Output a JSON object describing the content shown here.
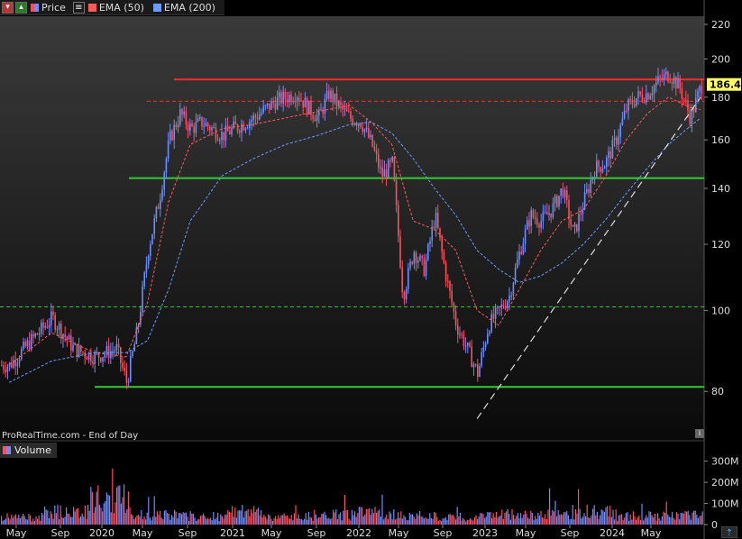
{
  "legend": {
    "price_label": "Price",
    "ema50_label": "EMA (50)",
    "ema200_label": "EMA (200)"
  },
  "volume_legend": {
    "label": "Volume"
  },
  "source_label": "ProRealTime.com - End of Day",
  "last_price": "186.43",
  "colors": {
    "background": "#000000",
    "candle_up": "#6b8dff",
    "candle_down": "#ff4d5a",
    "ema50": "#ff5a5a",
    "ema200": "#6a9cff",
    "resistance": "#ff2a2a",
    "support": "#33cc33",
    "trendline": "#dddddd",
    "last_price_badge": "#ffff66"
  },
  "chart_data": [
    {
      "type": "line",
      "title": "",
      "y_scale": "log",
      "ylim": [
        70,
        225
      ],
      "y_ticks": [
        80,
        100,
        120,
        140,
        160,
        180,
        200,
        220
      ],
      "x_ticks": [
        "May",
        "Sep",
        "2020",
        "May",
        "Sep",
        "2021",
        "May",
        "Sep",
        "2022",
        "May",
        "Sep",
        "2023",
        "May",
        "Sep",
        "2024",
        "May"
      ],
      "x_range": [
        "2019-04",
        "2024-09"
      ],
      "series": [
        {
          "name": "Price",
          "style": "candlestick",
          "x": [
            "2019-04",
            "2019-06",
            "2019-08",
            "2019-10",
            "2019-12",
            "2020-02",
            "2020-03",
            "2020-04",
            "2020-05",
            "2020-06",
            "2020-07",
            "2020-08",
            "2020-09",
            "2020-10",
            "2020-12",
            "2021-01",
            "2021-03",
            "2021-05",
            "2021-07",
            "2021-08",
            "2021-09",
            "2021-10",
            "2021-11",
            "2021-12",
            "2022-01",
            "2022-02",
            "2022-03",
            "2022-04",
            "2022-05",
            "2022-06",
            "2022-07",
            "2022-08",
            "2022-09",
            "2022-10",
            "2022-11",
            "2022-12",
            "2023-01",
            "2023-02",
            "2023-03",
            "2023-04",
            "2023-05",
            "2023-06",
            "2023-07",
            "2023-08",
            "2023-09",
            "2023-10",
            "2023-11",
            "2023-12",
            "2024-01",
            "2024-02",
            "2024-03",
            "2024-04",
            "2024-05",
            "2024-06",
            "2024-07",
            "2024-08",
            "2024-09"
          ],
          "values": [
            86,
            92,
            98,
            90,
            88,
            90,
            82,
            95,
            118,
            135,
            160,
            172,
            165,
            168,
            162,
            165,
            170,
            178,
            182,
            175,
            170,
            182,
            175,
            170,
            168,
            158,
            145,
            150,
            104,
            118,
            112,
            130,
            110,
            96,
            90,
            84,
            96,
            100,
            104,
            118,
            130,
            128,
            132,
            140,
            123,
            135,
            148,
            150,
            160,
            175,
            180,
            182,
            188,
            192,
            185,
            170,
            186
          ]
        },
        {
          "name": "EMA (50)",
          "x": [
            "2019-04",
            "2019-08",
            "2019-12",
            "2020-03",
            "2020-05",
            "2020-07",
            "2020-09",
            "2020-12",
            "2021-03",
            "2021-06",
            "2021-09",
            "2021-12",
            "2022-02",
            "2022-04",
            "2022-06",
            "2022-08",
            "2022-10",
            "2022-12",
            "2023-02",
            "2023-04",
            "2023-06",
            "2023-08",
            "2023-10",
            "2023-12",
            "2024-02",
            "2024-04",
            "2024-06",
            "2024-08",
            "2024-09"
          ],
          "values": [
            86,
            94,
            89,
            88,
            102,
            135,
            158,
            165,
            167,
            170,
            173,
            176,
            168,
            158,
            128,
            125,
            118,
            100,
            96,
            106,
            118,
            128,
            132,
            144,
            160,
            172,
            180,
            175,
            174
          ]
        },
        {
          "name": "EMA (200)",
          "x": [
            "2019-04",
            "2019-08",
            "2019-12",
            "2020-03",
            "2020-05",
            "2020-07",
            "2020-09",
            "2020-12",
            "2021-03",
            "2021-06",
            "2021-09",
            "2021-12",
            "2022-02",
            "2022-04",
            "2022-06",
            "2022-08",
            "2022-10",
            "2022-12",
            "2023-02",
            "2023-04",
            "2023-06",
            "2023-08",
            "2023-10",
            "2023-12",
            "2024-02",
            "2024-04",
            "2024-06",
            "2024-08",
            "2024-09"
          ],
          "values": [
            82,
            87,
            89,
            89,
            92,
            106,
            128,
            145,
            152,
            158,
            162,
            167,
            168,
            163,
            152,
            140,
            130,
            118,
            112,
            108,
            110,
            114,
            120,
            128,
            138,
            148,
            158,
            166,
            170
          ]
        }
      ],
      "reference_lines": [
        {
          "y": 189,
          "style": "solid",
          "color": "#ff2a2a"
        },
        {
          "y": 178,
          "style": "dashed",
          "color": "#ff2a2a"
        },
        {
          "y": 144,
          "style": "solid",
          "color": "#33cc33"
        },
        {
          "y": 101,
          "style": "dashed",
          "color": "#33cc33"
        },
        {
          "y": 81,
          "style": "solid",
          "color": "#33cc33"
        }
      ],
      "trendline": {
        "style": "dashed",
        "x": [
          "2022-12",
          "2024-09"
        ],
        "y": [
          78,
          180
        ]
      }
    },
    {
      "type": "bar",
      "title": "Volume",
      "ylim": [
        0,
        350
      ],
      "y_ticks": [
        "0",
        "100M",
        "200M",
        "300M"
      ],
      "description_levels_M": [
        35,
        60,
        120,
        45,
        40,
        60,
        35,
        45,
        55,
        40,
        35,
        50,
        45,
        60,
        40,
        45
      ]
    }
  ]
}
